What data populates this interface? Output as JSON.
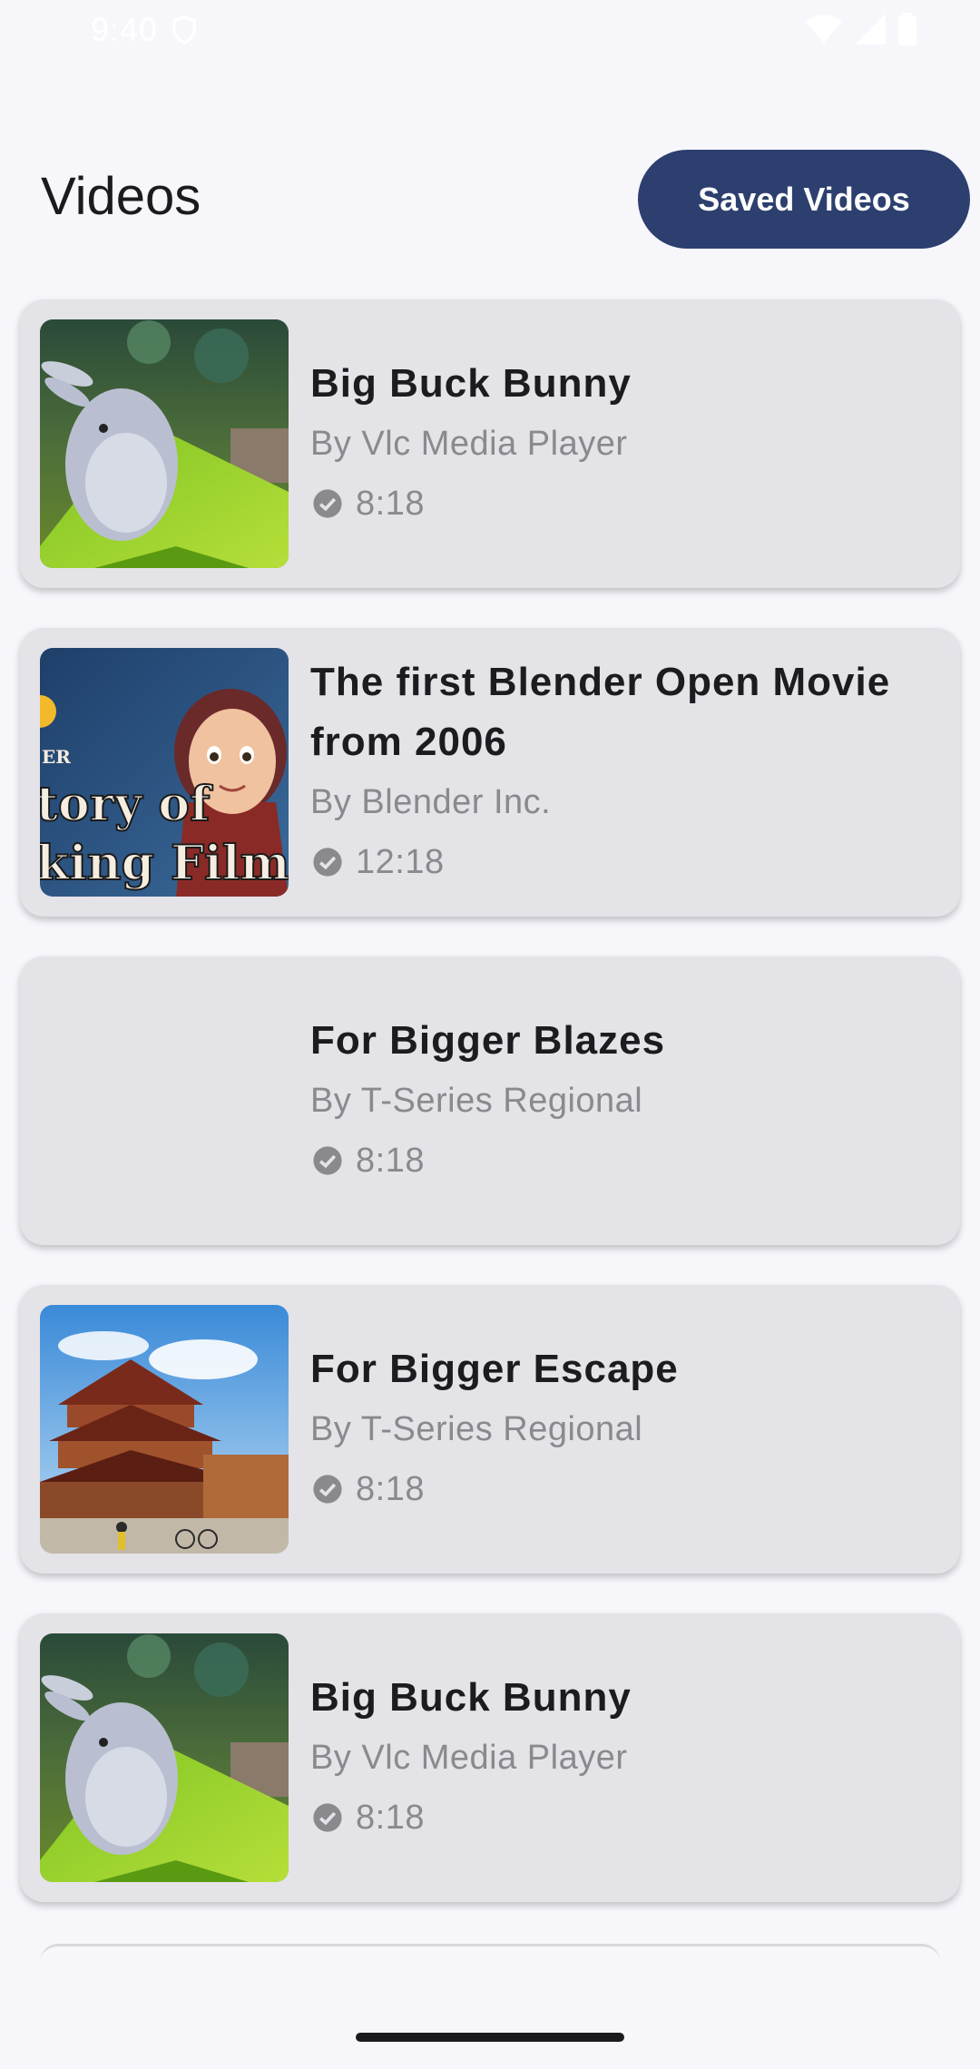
{
  "status_bar": {
    "time": "9:40",
    "icons": [
      "shield-icon",
      "wifi-icon",
      "cell-signal-icon",
      "battery-icon"
    ]
  },
  "header": {
    "title": "Videos",
    "saved_button_label": "Saved Videos"
  },
  "colors": {
    "accent": "#2c3f6e",
    "card_bg": "#e4e3e8",
    "screen_bg": "#f7f6fb",
    "secondary_text": "#8a898e"
  },
  "videos": [
    {
      "title": "Big Buck Bunny",
      "author": "By Vlc Media Player",
      "duration": "8:18",
      "thumbnail": "bunny"
    },
    {
      "title": "The first Blender Open Movie from 2006",
      "author": "By Blender Inc.",
      "duration": "12:18",
      "thumbnail": "animated-girl"
    },
    {
      "title": "For Bigger Blazes",
      "author": "By T-Series Regional",
      "duration": "8:18",
      "thumbnail": "none"
    },
    {
      "title": "For Bigger Escape",
      "author": "By T-Series Regional",
      "duration": "8:18",
      "thumbnail": "temple"
    },
    {
      "title": "Big Buck Bunny",
      "author": "By Vlc Media Player",
      "duration": "8:18",
      "thumbnail": "bunny"
    }
  ]
}
